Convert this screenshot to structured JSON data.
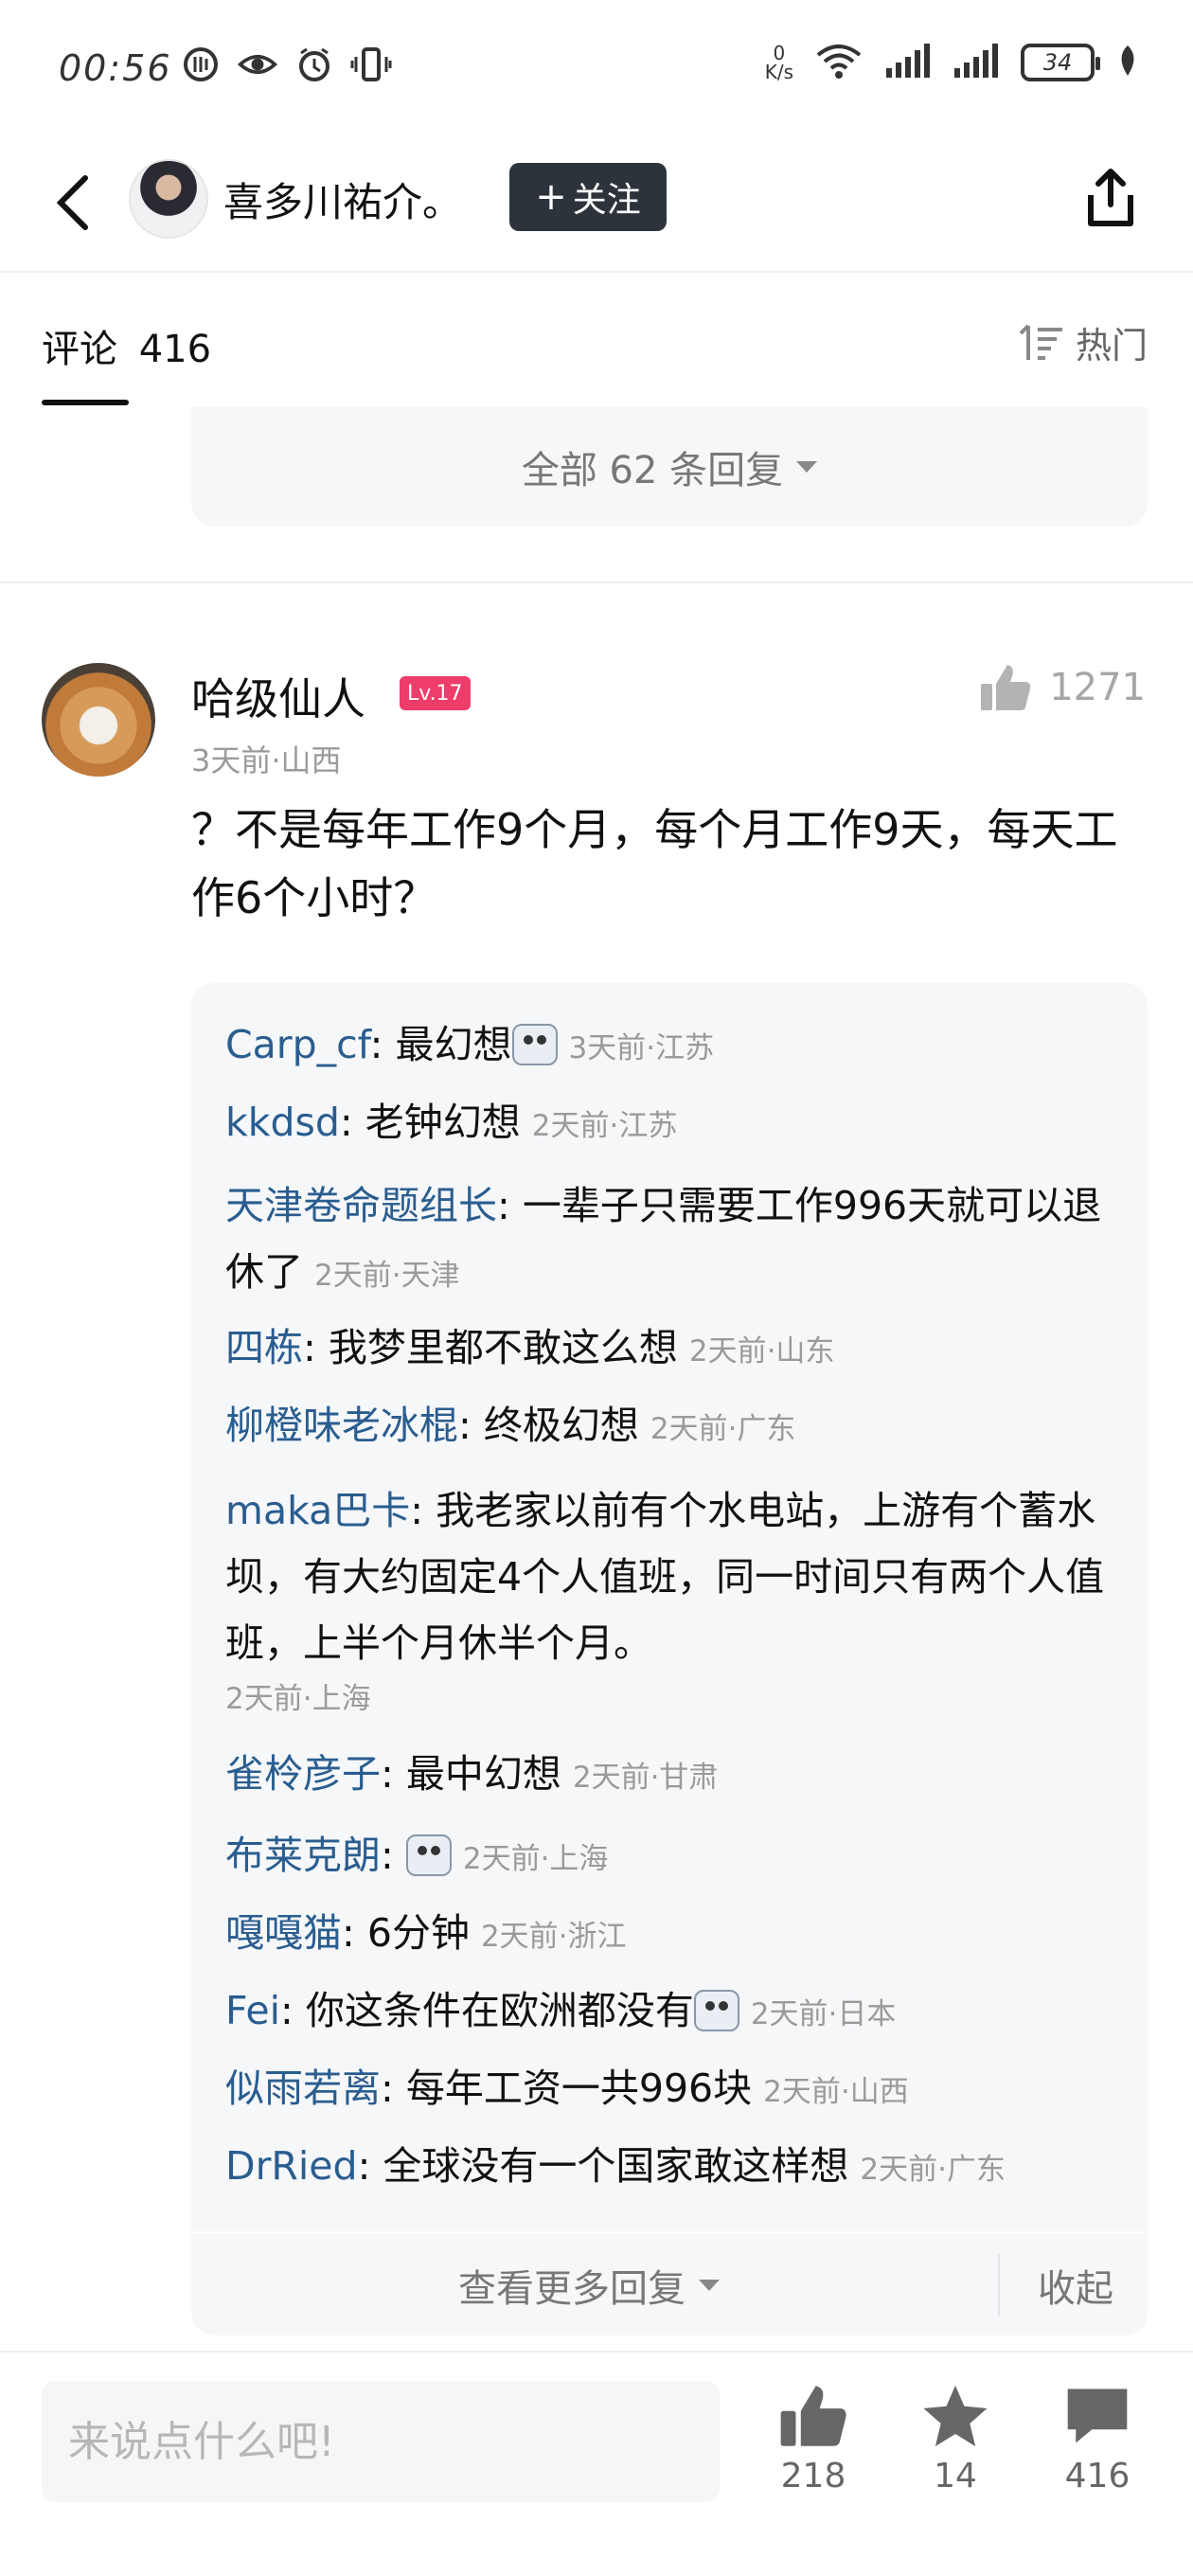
{
  "status_bar": {
    "time": "00:56",
    "net_speed_value": "0",
    "net_speed_unit": "K/s",
    "battery": "34"
  },
  "header": {
    "author_name": "喜多川祐介。",
    "follow_label": "关注"
  },
  "tabs": {
    "comments_label": "评论",
    "comments_count": "416",
    "sort_label": "热门"
  },
  "previous_thread": {
    "all_replies": "全部 62 条回复"
  },
  "comment": {
    "user": "哈级仙人",
    "level": "Lv.17",
    "meta": "3天前·山西",
    "likes": "1271",
    "text": "？不是每年工作9个月，每个月工作9天，每天工作6个小时？",
    "replies": [
      {
        "user": "Carp_cf",
        "text": "最幻想",
        "emoji": true,
        "meta": "3天前·江苏"
      },
      {
        "user": "kkdsd",
        "text": "老钟幻想",
        "emoji": false,
        "meta": "2天前·江苏"
      },
      {
        "user": "天津卷命题组长",
        "text": "一辈子只需要工作996天就可以退休了",
        "emoji": false,
        "meta": "2天前·天津"
      },
      {
        "user": "四栋",
        "text": "我梦里都不敢这么想",
        "emoji": false,
        "meta": "2天前·山东"
      },
      {
        "user": "柳橙味老冰棍",
        "text": "终极幻想",
        "emoji": false,
        "meta": "2天前·广东"
      },
      {
        "user": "maka巴卡",
        "text": "我老家以前有个水电站，上游有个蓄水坝，有大约固定4个人值班，同一时间只有两个人值班，上半个月休半个月。",
        "emoji": false,
        "meta": "2天前·上海"
      },
      {
        "user": "雀柃彦子",
        "text": "最中幻想",
        "emoji": false,
        "meta": "2天前·甘肃"
      },
      {
        "user": "布莱克朗",
        "text": "",
        "emoji": true,
        "meta": "2天前·上海"
      },
      {
        "user": "嘎嘎猫",
        "text": "6分钟",
        "emoji": false,
        "meta": "2天前·浙江"
      },
      {
        "user": "Fei",
        "text": "你这条件在欧洲都没有",
        "emoji": true,
        "meta": "2天前·日本"
      },
      {
        "user": "似雨若离",
        "text": "每年工资一共996块",
        "emoji": false,
        "meta": "2天前·山西"
      },
      {
        "user": "DrRied",
        "text": "全球没有一个国家敢这样想",
        "emoji": false,
        "meta": "2天前·广东"
      }
    ],
    "more_replies": "查看更多回复",
    "collapse": "收起"
  },
  "bottom_bar": {
    "placeholder": "来说点什么吧!",
    "likes": "218",
    "favorites": "14",
    "comments": "416"
  }
}
